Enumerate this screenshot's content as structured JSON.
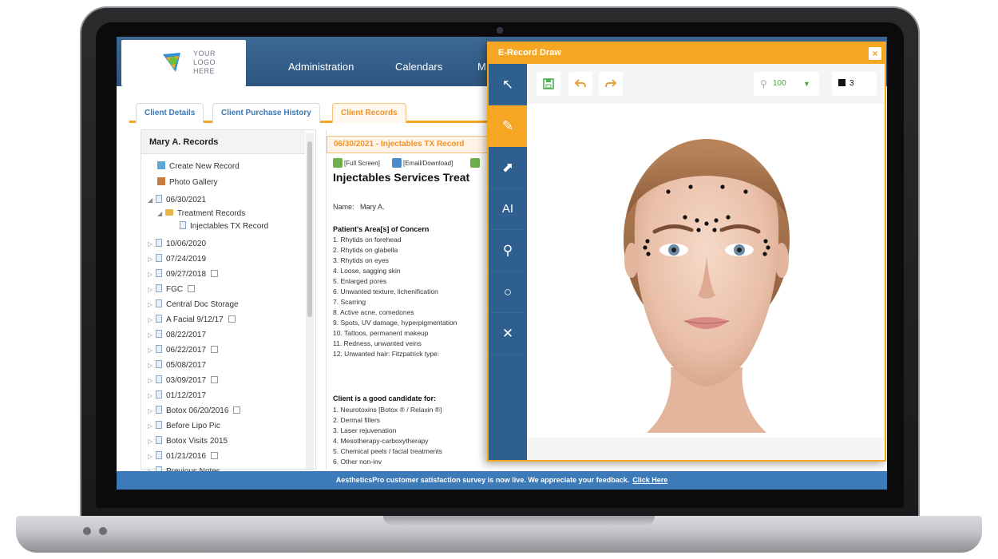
{
  "header": {
    "logo_text": [
      "YOUR",
      "LOGO",
      "HERE"
    ],
    "nav": [
      "Administration",
      "Calendars",
      "M"
    ]
  },
  "tabs": [
    "Client Details",
    "Client Purchase History",
    "Client Records"
  ],
  "tree": {
    "title": "Mary A. Records",
    "top_items": [
      "Create New Record",
      "Photo Gallery"
    ],
    "expanded_date": "06/30/2021",
    "folder": "Treatment Records",
    "leaf": "Injectables TX Record",
    "items": [
      "10/06/2020",
      "07/24/2019",
      "09/27/2018",
      "FGC",
      "Central Doc Storage",
      "A Facial 9/12/17",
      "08/22/2017",
      "06/22/2017",
      "05/08/2017",
      "03/09/2017",
      "01/12/2017",
      "Botox 06/20/2016",
      "Before Lipo Pic",
      "Botox Visits 2015",
      "01/21/2016",
      "Previous Notes"
    ]
  },
  "record": {
    "tab_label": "06/30/2021 - Injectables TX Record",
    "tool_links": [
      "[Full Screen]",
      "[Email/Download]"
    ],
    "title": "Injectables Services Treat",
    "name_label": "Name:",
    "name_value": "Mary A.",
    "concern_heading": "Patient's Area[s] of Concern",
    "concerns": [
      "1. Rhytids on forehead",
      "2. Rhytids on glabella",
      "3. Rhytids on eyes",
      "4. Loose, sagging skin",
      "5. Enlarged pores",
      "6. Unwanted texture, lichenification",
      "7. Scarring",
      "8. Active acne, comedones",
      "9. Spots, UV damage, hyperpigmentation",
      "10. Tattoos, permanent makeup",
      "11. Redness, unwanted veins",
      "12. Unwanted hair: Fitzpatrick type:"
    ],
    "candidate_heading": "Client is a good candidate for:",
    "candidates": [
      "1. Neurotoxins [Botox ® / Relaxin ®]",
      "2. Dermal fillers",
      "3. Laser rejuvenation",
      "4. Mesotherapy-carboxytherapy",
      "5. Chemical peels / facial treatments",
      "6. Other non-inv"
    ]
  },
  "draw": {
    "title": "E-Record Draw",
    "close_label": "×",
    "side_tools": [
      "↖",
      "✎",
      "⬈",
      "AI",
      "⚲",
      "○",
      "✕"
    ],
    "zoom": "100",
    "brush_size": "3"
  },
  "survey": {
    "message": "AestheticsPro customer satisfaction survey is now live. We appreciate your feedback.",
    "link": "Click Here"
  },
  "colors": {
    "accent_orange": "#f5a623",
    "sidebar_blue": "#2f5f8f",
    "header_blue": "#3d6995"
  }
}
